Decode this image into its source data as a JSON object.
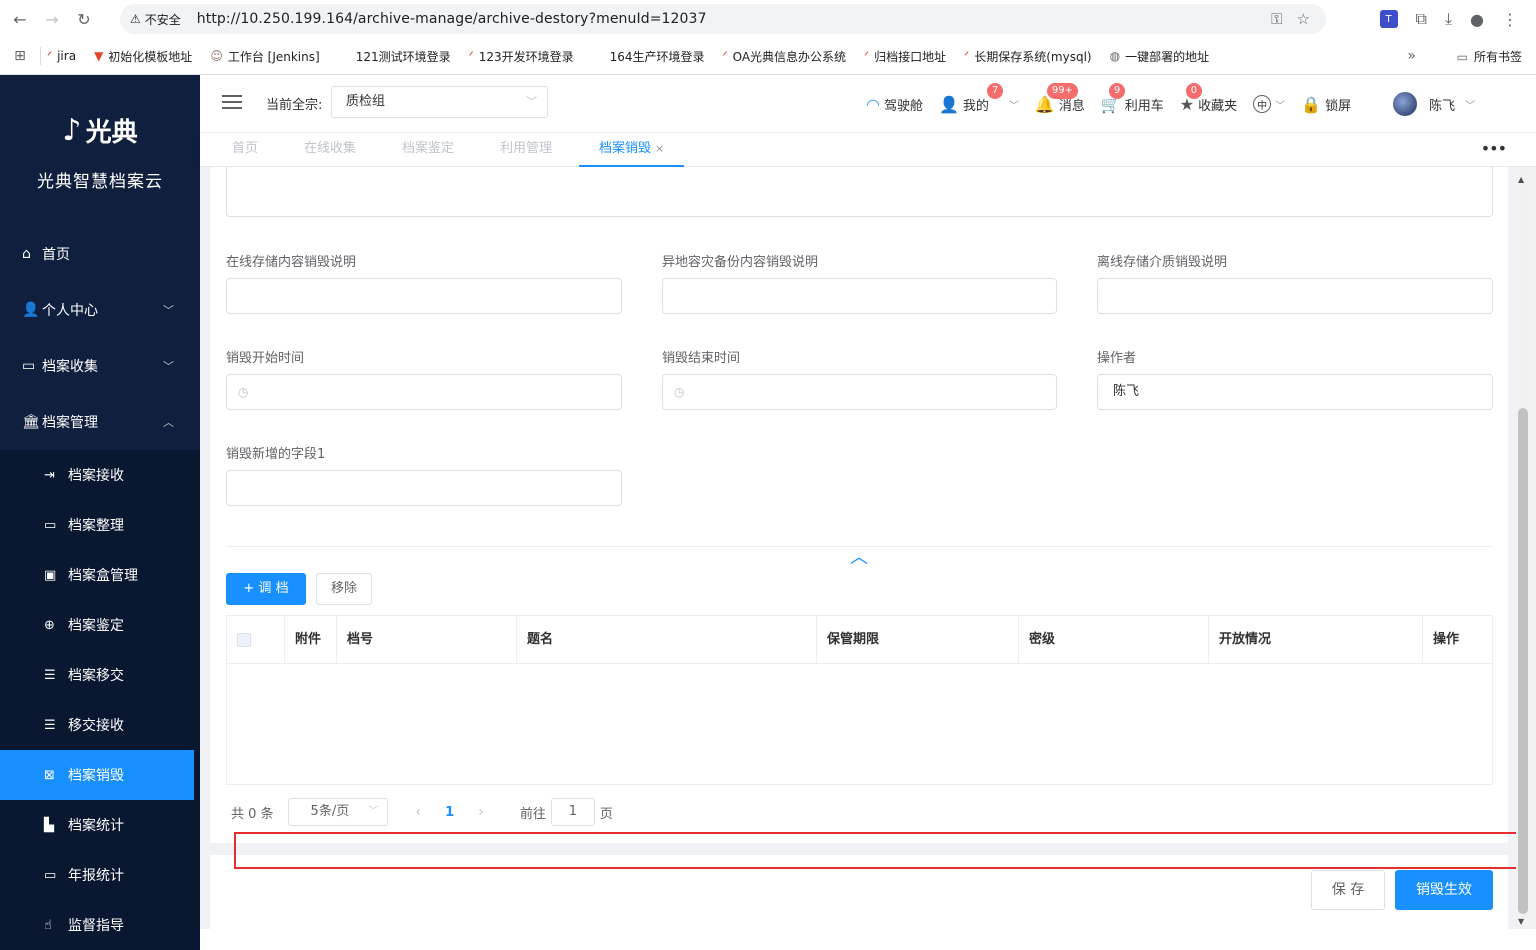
{
  "browser": {
    "insecure_label": "不安全",
    "url": "http://10.250.199.164/archive-manage/archive-destory?menuId=12037",
    "bookmarks": [
      {
        "label": "jira"
      },
      {
        "label": "初始化模板地址"
      },
      {
        "label": "工作台 [Jenkins]"
      },
      {
        "label": "121测试环境登录"
      },
      {
        "label": "123开发环境登录"
      },
      {
        "label": "164生产环境登录"
      },
      {
        "label": "OA光典信息办公系统"
      },
      {
        "label": "归档接口地址"
      },
      {
        "label": "长期保存系统(mysql)"
      },
      {
        "label": "一键部署的地址"
      }
    ],
    "all_bookmarks": "所有书签"
  },
  "sidebar": {
    "logo_text": "光典",
    "app_name": "光典智慧档案云",
    "items": [
      {
        "label": "首页",
        "icon": "home-icon"
      },
      {
        "label": "个人中心",
        "icon": "user-icon"
      },
      {
        "label": "档案收集",
        "icon": "briefcase-icon"
      },
      {
        "label": "档案管理",
        "icon": "bank-icon"
      }
    ],
    "sub_items": [
      {
        "label": "档案接收",
        "icon": "import-icon"
      },
      {
        "label": "档案整理",
        "icon": "folder-icon"
      },
      {
        "label": "档案盒管理",
        "icon": "box-icon"
      },
      {
        "label": "档案鉴定",
        "icon": "crosshair-icon"
      },
      {
        "label": "档案移交",
        "icon": "list-icon"
      },
      {
        "label": "移交接收",
        "icon": "list-icon"
      },
      {
        "label": "档案销毁",
        "icon": "destroy-icon"
      },
      {
        "label": "档案统计",
        "icon": "bar-chart-icon"
      },
      {
        "label": "年报统计",
        "icon": "monitor-icon"
      },
      {
        "label": "监督指导",
        "icon": "hand-icon"
      }
    ]
  },
  "header": {
    "zong_label": "当前全宗:",
    "zong_value": "质检组",
    "cockpit": "驾驶舱",
    "mine": "我的",
    "mine_badge": "7",
    "messages": "消息",
    "messages_badge": "99+",
    "cart": "利用车",
    "cart_badge": "9",
    "favorites": "收藏夹",
    "favorites_badge": "0",
    "lang": "中",
    "lock": "锁屏",
    "user_name": "陈飞"
  },
  "tabs": [
    {
      "label": "首页"
    },
    {
      "label": "在线收集"
    },
    {
      "label": "档案鉴定"
    },
    {
      "label": "利用管理"
    },
    {
      "label": "档案销毁"
    }
  ],
  "form": {
    "online_label": "在线存储内容销毁说明",
    "online_value": "",
    "offsite_label": "异地容灾备份内容销毁说明",
    "offsite_value": "",
    "offline_label": "离线存储介质销毁说明",
    "offline_value": "",
    "start_label": "销毁开始时间",
    "end_label": "销毁结束时间",
    "operator_label": "操作者",
    "operator_value": "陈飞",
    "extra_label": "销毁新增的字段1",
    "extra_value": ""
  },
  "actions": {
    "add_label": "+ 调 档",
    "remove_label": "移除"
  },
  "table": {
    "columns": [
      "附件",
      "档号",
      "题名",
      "保管期限",
      "密级",
      "开放情况",
      "操作"
    ],
    "rows": []
  },
  "pagination": {
    "total": "共 0 条",
    "page_size": "5条/页",
    "current": "1",
    "goto_prefix": "前往",
    "goto_value": "1",
    "goto_suffix": "页"
  },
  "footer": {
    "save_label": "保 存",
    "confirm_label": "销毁生效"
  }
}
